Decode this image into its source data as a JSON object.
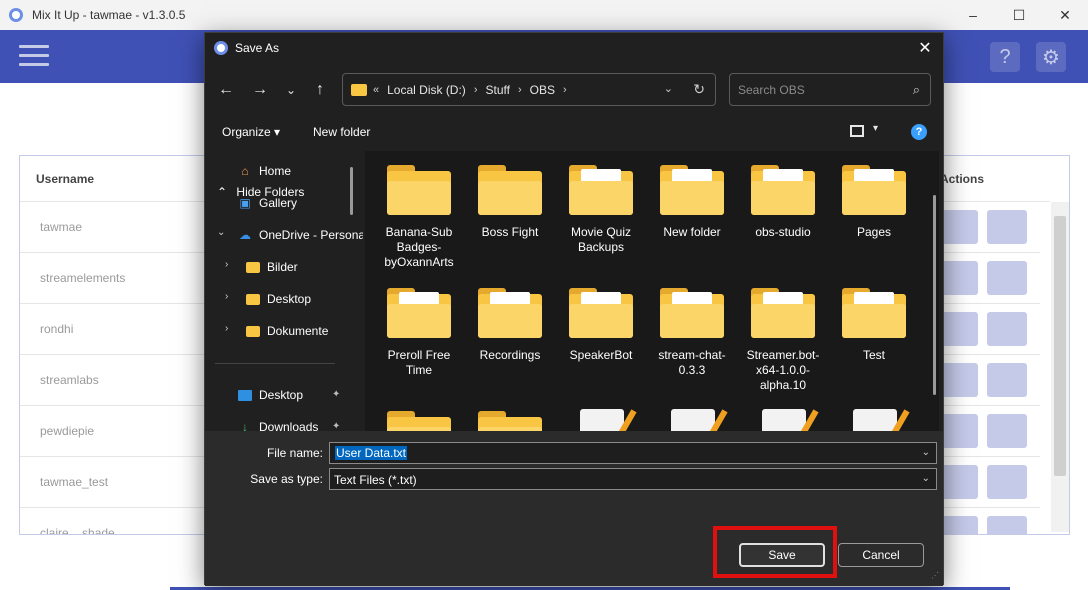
{
  "app": {
    "title": "Mix It Up - tawmae - v1.3.0.5",
    "window_controls": {
      "minimize": "–",
      "maximize": "☐",
      "close": "✕"
    },
    "header_icons": {
      "help": "?",
      "settings": "⚙"
    },
    "colors": {
      "header": "#3f51b5",
      "accent_light": "#c5cae9"
    },
    "table": {
      "headers": {
        "username": "Username",
        "actions": "Actions"
      },
      "rows": [
        "tawmae",
        "streamelements",
        "rondhi",
        "streamlabs",
        "pewdiepie",
        "tawmae_test",
        "claire__shade"
      ]
    }
  },
  "dialog": {
    "title": "Save As",
    "close": "✕",
    "nav": {
      "back": "←",
      "forward": "→",
      "recent": "⌄",
      "up": "↑"
    },
    "address": {
      "overflow": "«",
      "crumbs": [
        "Local Disk (D:)",
        "Stuff",
        "OBS"
      ],
      "sep": "›",
      "dropdown": "⌄",
      "refresh": "↻"
    },
    "search": {
      "placeholder": "Search OBS",
      "icon": "⌕"
    },
    "commands": {
      "organize": "Organize ▾",
      "new_folder": "New folder",
      "help": "?",
      "view_dd": "▾"
    },
    "nav_pane": {
      "items": [
        {
          "label": "Home",
          "icon": "⌂"
        },
        {
          "label": "Gallery",
          "icon": "▣"
        },
        {
          "label": "OneDrive - Personal",
          "icon": "☁",
          "chevron": "⌄"
        },
        {
          "label": "Bilder",
          "chevron": "›"
        },
        {
          "label": "Desktop",
          "chevron": "›"
        },
        {
          "label": "Dokumente",
          "chevron": "›"
        },
        {
          "label": "Desktop",
          "pin": "✦"
        },
        {
          "label": "Downloads",
          "icon": "↓",
          "pin": "✦"
        }
      ]
    },
    "folders": [
      "Banana-Sub Badges-byOxannArts",
      "Boss Fight",
      "Movie Quiz Backups",
      "New folder",
      "obs-studio",
      "Pages",
      "Preroll Free Time",
      "Recordings",
      "SpeakerBot",
      "stream-chat-0.3.3",
      "Streamer.bot-x64-1.0.0-alpha.10",
      "Test"
    ],
    "form": {
      "file_name_label": "File name:",
      "file_name_value": "User Data.txt",
      "save_type_label": "Save as type:",
      "save_type_value": "Text Files (*.txt)",
      "dd_arrow": "⌄"
    },
    "footer": {
      "hide_folders": "Hide Folders",
      "hide_icon": "⌃",
      "save": "Save",
      "cancel": "Cancel",
      "grip": "⋰"
    },
    "colors": {
      "bg": "#202020",
      "folder": "#f8c642",
      "selection": "#0067c0",
      "highlight": "#e01010"
    }
  }
}
